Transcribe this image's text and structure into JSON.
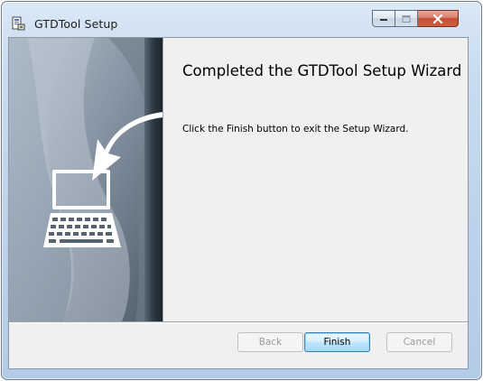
{
  "window": {
    "title": "GTDTool Setup",
    "caption_buttons": [
      "minimize",
      "maximize",
      "close"
    ]
  },
  "wizard": {
    "headline": "Completed the GTDTool Setup Wizard",
    "body": "Click the Finish button to exit the Setup Wizard."
  },
  "buttons": {
    "back": "Back",
    "finish": "Finish",
    "cancel": "Cancel"
  },
  "icons": {
    "app": "installer-package-icon",
    "banner": "computer-return-arrow-illustration"
  },
  "colors": {
    "banner_dark": "#2f3c48",
    "banner_light": "#9aa9b8",
    "finish_border": "#3c7fb1",
    "close_button": "#c74c33"
  }
}
